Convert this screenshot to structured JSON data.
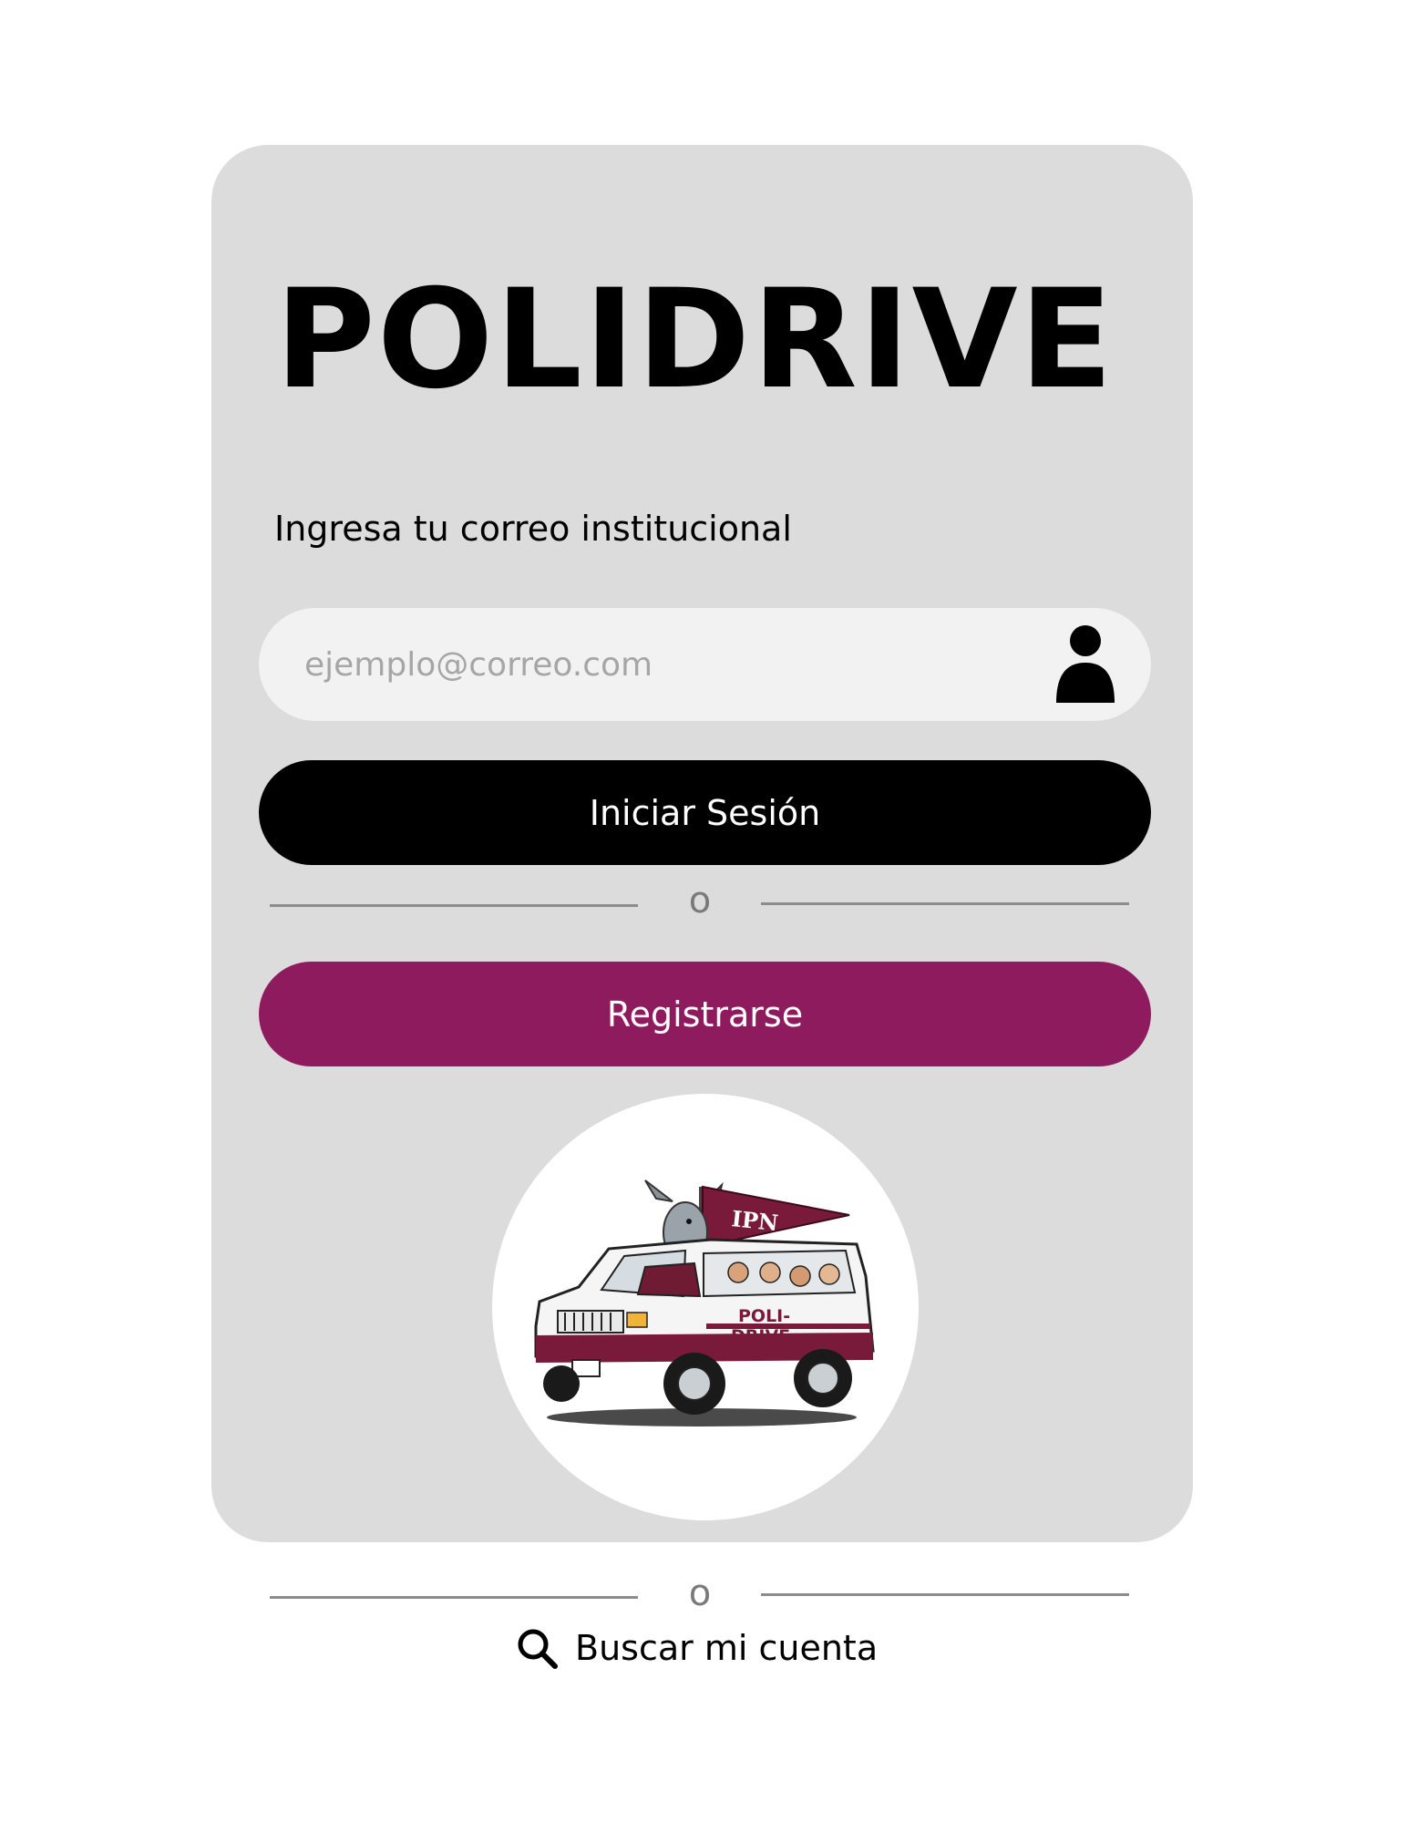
{
  "app": {
    "title": "POLIDRIVE"
  },
  "login": {
    "email_label": "Ingresa tu correo institucional",
    "email_placeholder": "ejemplo@correo.com",
    "email_value": "",
    "login_button": "Iniciar Sesión",
    "divider_text": "o",
    "register_button": "Registrarse"
  },
  "logo": {
    "flag_text": "IPN",
    "vehicle_text_line1": "POLI-",
    "vehicle_text_line2": "DRIVE"
  },
  "footer": {
    "divider_text": "o",
    "search_account_label": "Buscar mi cuenta",
    "search_icon": "search-icon"
  },
  "colors": {
    "card_background": "#dcdcdc",
    "input_background": "#f2f2f2",
    "login_button": "#000000",
    "register_button": "#8e1b5e",
    "brand_maroon": "#7a1a3a"
  }
}
